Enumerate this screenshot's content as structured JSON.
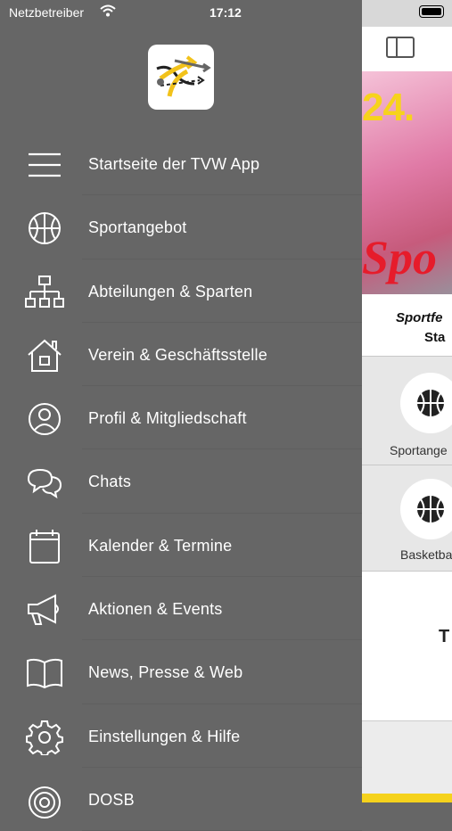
{
  "status": {
    "carrier": "Netzbetreiber",
    "time": "17:12"
  },
  "drawer": {
    "items": [
      {
        "label": "Startseite der TVW App",
        "icon": "hamburger-icon"
      },
      {
        "label": "Sportangebot",
        "icon": "basketball-icon"
      },
      {
        "label": "Abteilungen & Sparten",
        "icon": "org-chart-icon"
      },
      {
        "label": "Verein & Geschäftsstelle",
        "icon": "house-icon"
      },
      {
        "label": "Profil & Mitgliedschaft",
        "icon": "profile-icon"
      },
      {
        "label": "Chats",
        "icon": "chat-bubbles-icon"
      },
      {
        "label": "Kalender & Termine",
        "icon": "calendar-icon"
      },
      {
        "label": "Aktionen & Events",
        "icon": "megaphone-icon"
      },
      {
        "label": "News, Presse & Web",
        "icon": "book-icon"
      },
      {
        "label": "Einstellungen & Hilfe",
        "icon": "gear-icon"
      },
      {
        "label": "DOSB",
        "icon": "target-icon"
      }
    ]
  },
  "main": {
    "banner": {
      "date": "24.",
      "script": "Spo",
      "caption_line1": "Sportfe",
      "caption_line2": "Sta"
    },
    "tiles": [
      {
        "label": "Sportange"
      },
      {
        "label": "Basketba"
      }
    ],
    "big_text": "T"
  },
  "colors": {
    "drawer_bg": "#666666",
    "accent_yellow": "#f5d21c",
    "banner_red": "#e61c2b"
  }
}
